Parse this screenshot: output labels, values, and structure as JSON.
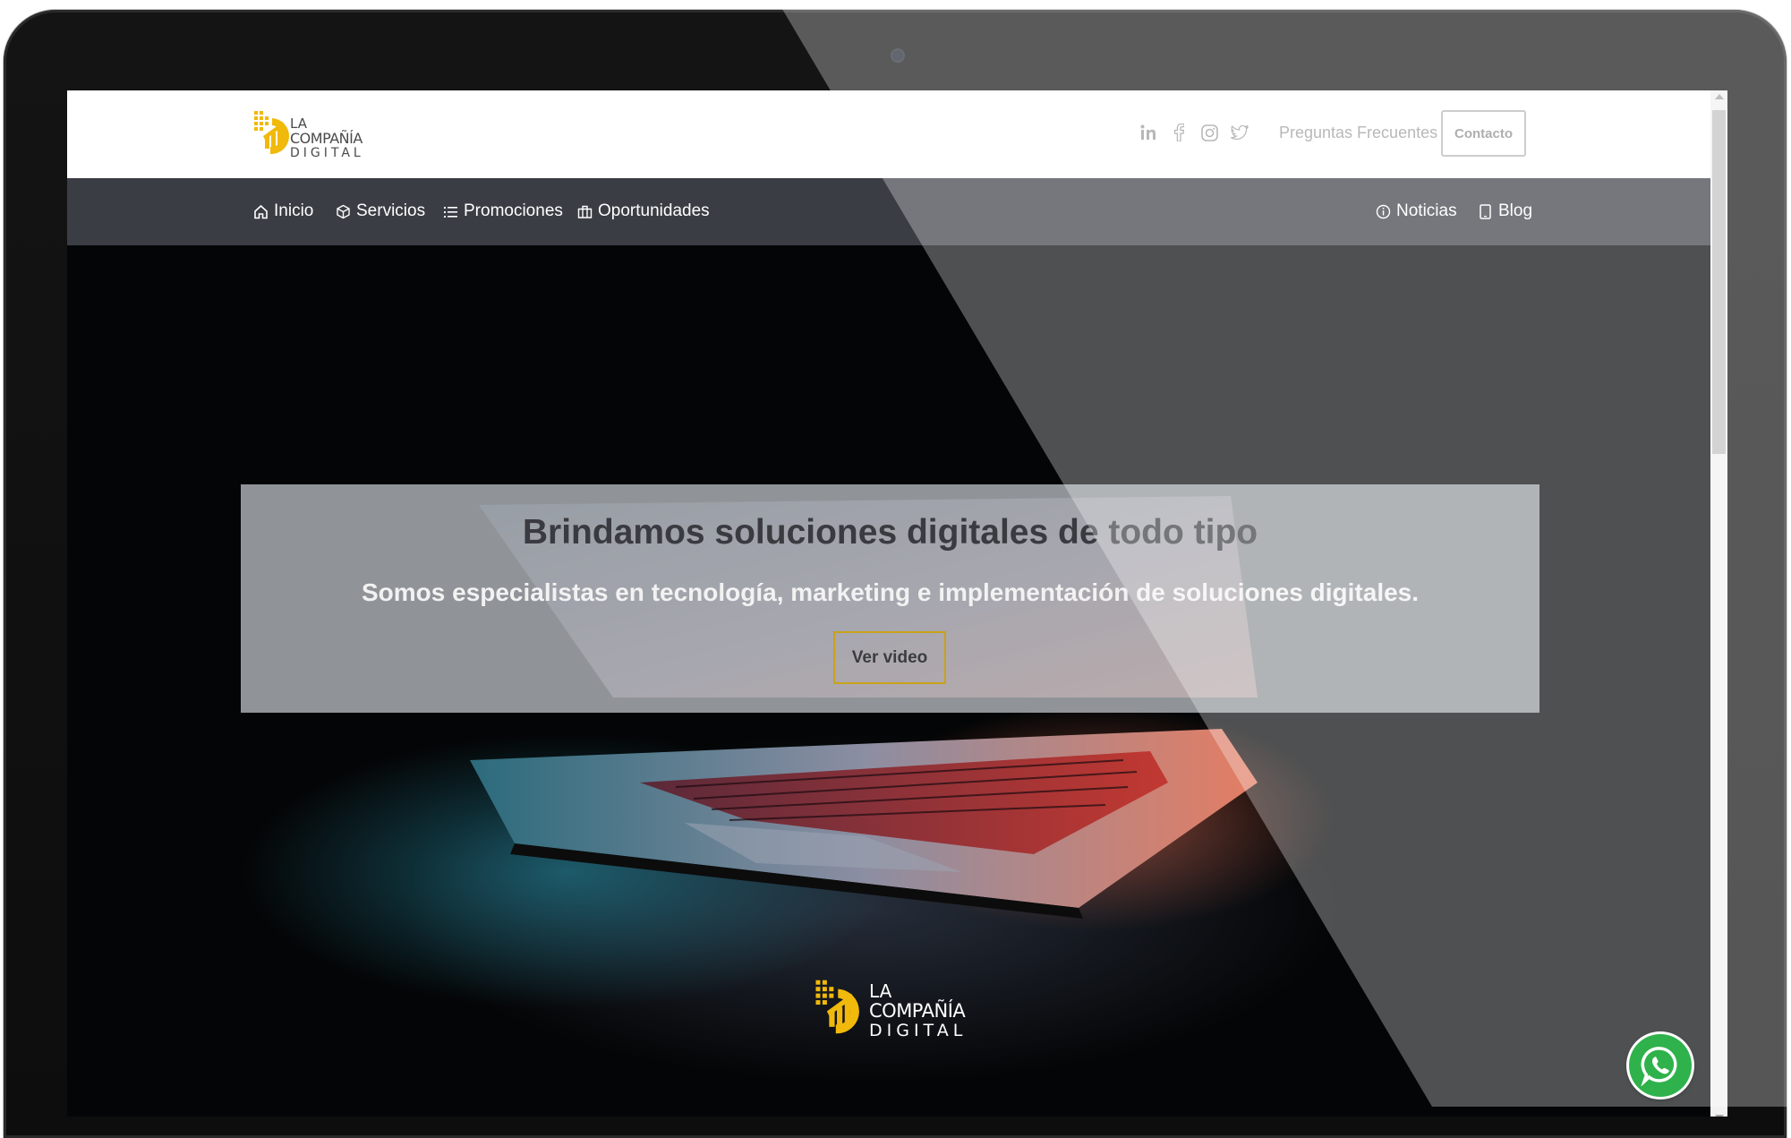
{
  "header": {
    "logo": {
      "line1": "LA",
      "line2": "COMPAÑÍA",
      "line3": "DIGITAL"
    },
    "social": [
      "linkedin-icon",
      "facebook-icon",
      "instagram-icon",
      "twitter-icon"
    ],
    "faq_label": "Preguntas Frecuentes",
    "contact_label": "Contacto"
  },
  "nav": {
    "left": [
      {
        "label": "Inicio",
        "icon": "home-icon"
      },
      {
        "label": "Servicios",
        "icon": "box-icon"
      },
      {
        "label": "Promociones",
        "icon": "list-icon"
      },
      {
        "label": "Oportunidades",
        "icon": "briefcase-icon"
      }
    ],
    "right": [
      {
        "label": "Noticias",
        "icon": "info-icon"
      },
      {
        "label": "Blog",
        "icon": "tablet-icon"
      }
    ]
  },
  "hero": {
    "title": "Brindamos soluciones digitales de todo tipo",
    "subtitle": "Somos especialistas en tecnología, marketing e implementación de soluciones digitales.",
    "video_label": "Ver video",
    "logo": {
      "line1": "LA",
      "line2": "COMPAÑÍA",
      "line3": "DIGITAL"
    }
  },
  "widgets": {
    "whatsapp_icon": "whatsapp-icon"
  },
  "colors": {
    "brand_yellow": "#f0b90b",
    "nav_bg": "#3a3d44",
    "whatsapp_green": "#2fb24b"
  }
}
